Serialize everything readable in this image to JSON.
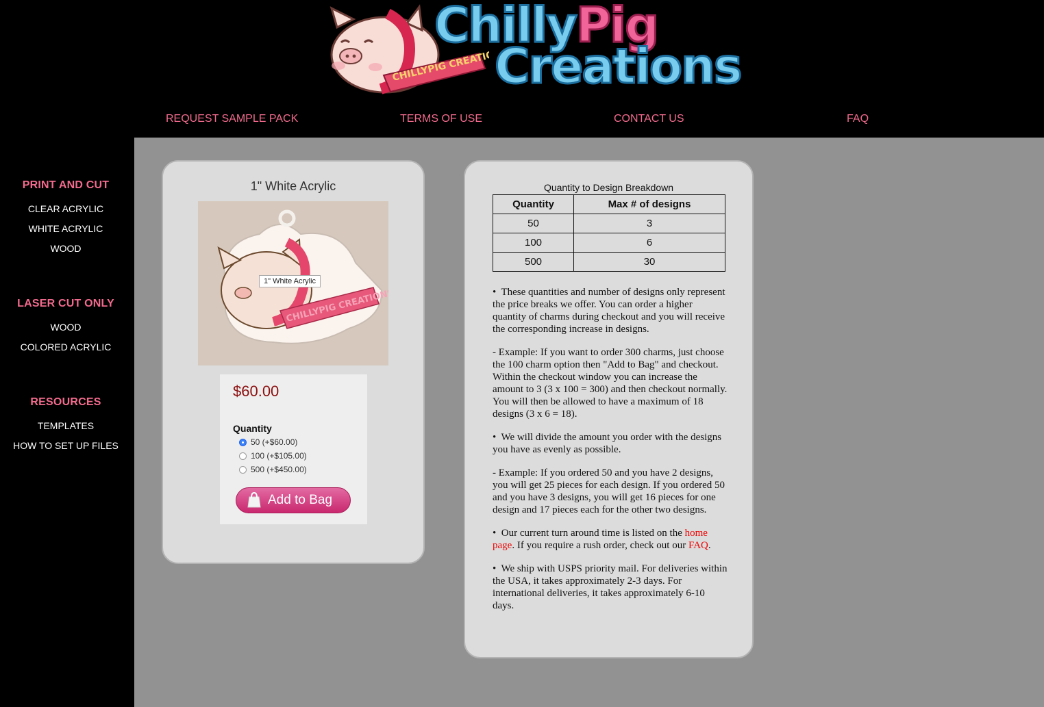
{
  "header": {
    "logo_text_1a": "Chilly",
    "logo_text_1b": "Pig",
    "logo_text_2": "Creations",
    "logo_ribbon_text": "CHILLYPIG CREATIONS",
    "nav": [
      {
        "label": "REQUEST SAMPLE PACK"
      },
      {
        "label": "TERMS OF USE"
      },
      {
        "label": "CONTACT US"
      },
      {
        "label": "FAQ"
      }
    ]
  },
  "sidebar": {
    "sections": [
      {
        "heading": "PRINT AND CUT",
        "items": [
          "CLEAR ACRYLIC",
          "WHITE ACRYLIC",
          "WOOD"
        ]
      },
      {
        "heading": "LASER CUT ONLY",
        "items": [
          "WOOD",
          "COLORED ACRYLIC"
        ]
      },
      {
        "heading": "RESOURCES",
        "items": [
          "TEMPLATES",
          "HOW TO SET UP FILES"
        ]
      }
    ]
  },
  "product": {
    "title": "1\" White Acrylic",
    "image_tooltip": "1\" White Acrylic",
    "image_ribbon_text": "CHILLYPIG CREATIONS",
    "price": "$60.00",
    "quantity_label": "Quantity",
    "options": [
      {
        "label": "50 (+$60.00)",
        "selected": true
      },
      {
        "label": "100 (+$105.00)",
        "selected": false
      },
      {
        "label": "500 (+$450.00)",
        "selected": false
      }
    ],
    "add_to_bag": "Add to Bag"
  },
  "info": {
    "table_caption": "Quantity to Design Breakdown",
    "table_headers": [
      "Quantity",
      "Max # of designs"
    ],
    "table_rows": [
      [
        "50",
        "3"
      ],
      [
        "100",
        "6"
      ],
      [
        "500",
        "30"
      ]
    ],
    "note_1": "These quantities and number of designs only represent the price breaks we offer. You can order a higher quantity of charms during checkout and you will receive the corresponding increase in designs.",
    "note_2": "- Example: If you want to order 300 charms, just choose the 100 charm option then \"Add to Bag\" and checkout. Within the checkout window you can increase the amount to 3 (3 x 100 = 300) and then checkout normally. You will then be allowed to have a maximum of 18 designs (3 x 6 = 18).",
    "note_3": "We will divide the amount you order with the designs you have as evenly as possible.",
    "note_4": "- Example: If you ordered 50 and you have 2 designs, you will get 25 pieces for each design. If you ordered 50 and you have 3 designs, you will get 16 pieces for one design and 17 pieces each for the other two designs.",
    "note_5_pre": "Our current turn around time is listed on the ",
    "note_5_link1": "home page",
    "note_5_mid": ". If you require a rush order, check out our ",
    "note_5_link2": "FAQ",
    "note_5_post": ".",
    "note_6": "We ship with USPS priority mail. For deliveries within the USA, it takes approximately 2-3 days. For international deliveries, it takes approximately 6-10 days."
  },
  "colors": {
    "nav_link": "#f36b8e",
    "price": "#8b0f0f",
    "link_red": "#ee0000",
    "add_button": "#c9286f"
  }
}
